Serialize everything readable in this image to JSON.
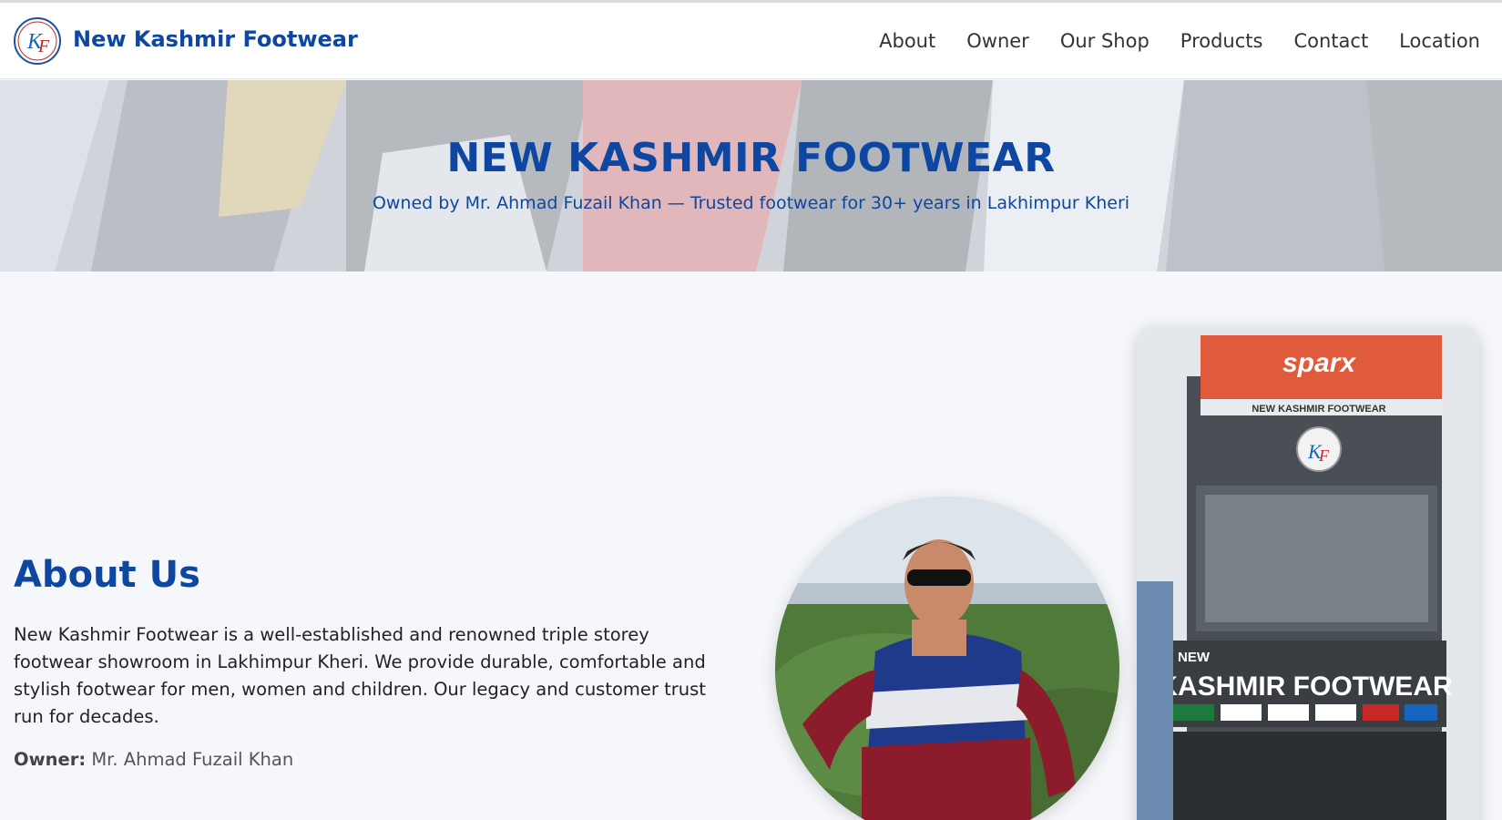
{
  "header": {
    "logo_icon": "kf-logo-icon",
    "brand": "New Kashmir Footwear",
    "nav": [
      "About",
      "Owner",
      "Our Shop",
      "Products",
      "Contact",
      "Location"
    ]
  },
  "hero": {
    "title": "NEW KASHMIR FOOTWEAR",
    "subtitle": "Owned by Mr. Ahmad Fuzail Khan — Trusted footwear for 30+ years in Lakhimpur Kheri"
  },
  "about": {
    "title": "About Us",
    "text": "New Kashmir Footwear is a well-established and renowned triple storey footwear showroom in Lakhimpur Kheri. We provide durable, comfortable and stylish footwear for men, women and children. Our legacy and customer trust run for decades.",
    "owner_label": "Owner:",
    "owner_name": "Mr. Ahmad Fuzail Khan"
  },
  "shop_sign": {
    "top": "sparx",
    "strip": "NEW KASHMIR FOOTWEAR",
    "new": "NEW",
    "main": "KASHMIR FOOTWEAR"
  },
  "colors": {
    "brand_blue": "#0d47a1",
    "text": "#222222",
    "background": "#f5f7fa"
  }
}
